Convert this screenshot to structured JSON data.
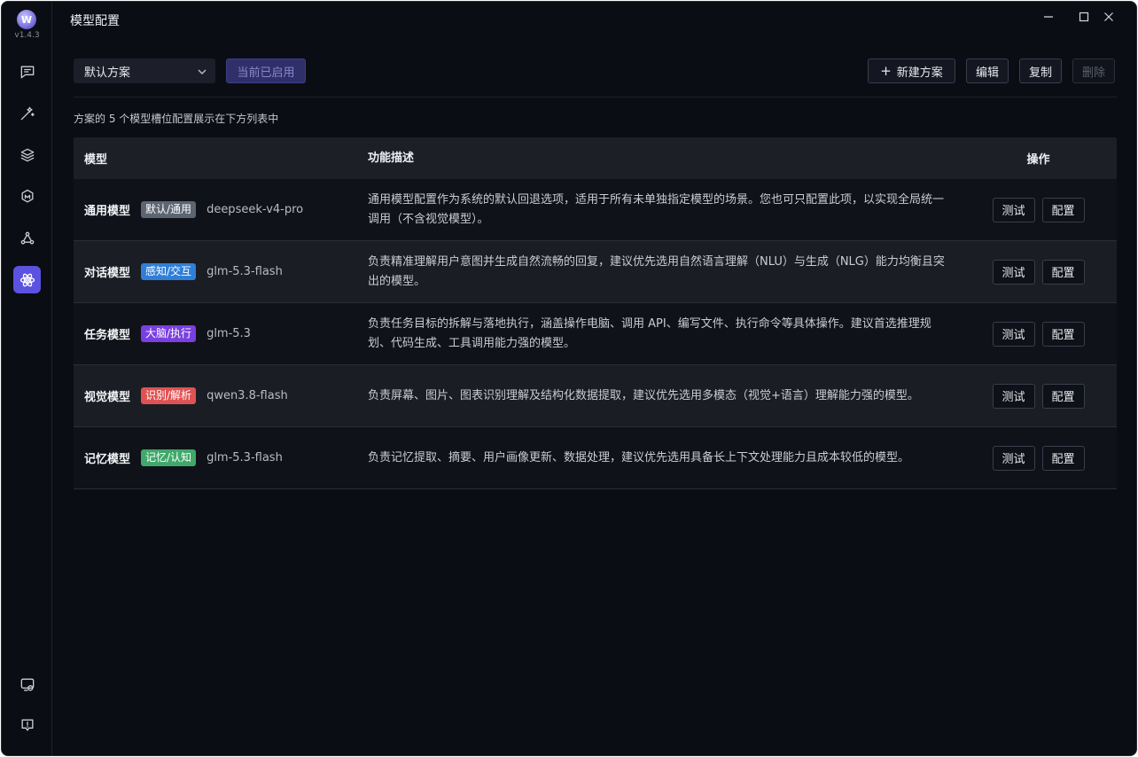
{
  "app": {
    "version": "v1.4.3",
    "logo_letter": "W"
  },
  "window": {
    "title": "模型配置"
  },
  "sidebar": {
    "nav": [
      {
        "icon": "chat-settings-icon"
      },
      {
        "icon": "magic-wand-icon"
      },
      {
        "icon": "layers-icon"
      },
      {
        "icon": "model-badge-icon"
      },
      {
        "icon": "network-icon"
      },
      {
        "icon": "atom-icon",
        "active": true
      }
    ],
    "bottom": [
      {
        "icon": "settings-screen-icon"
      },
      {
        "icon": "info-icon"
      }
    ]
  },
  "toolbar": {
    "scheme_value": "默认方案",
    "current_enabled_label": "当前已启用",
    "new_scheme_label": "新建方案",
    "edit_label": "编辑",
    "copy_label": "复制",
    "delete_label": "删除"
  },
  "summary": "方案的 5 个模型槽位配置展示在下方列表中",
  "table": {
    "headers": {
      "model": "模型",
      "desc": "功能描述",
      "ops": "操作"
    },
    "test_label": "测试",
    "config_label": "配置",
    "rows": [
      {
        "name": "通用模型",
        "tag": "默认/通用",
        "tag_color": "#5d6472",
        "model": "deepseek-v4-pro",
        "desc": "通用模型配置作为系统的默认回退选项，适用于所有未单独指定模型的场景。您也可只配置此项，以实现全局统一调用（不含视觉模型）。"
      },
      {
        "name": "对话模型",
        "tag": "感知/交互",
        "tag_color": "#2f7fd8",
        "model": "glm-5.3-flash",
        "desc": "负责精准理解用户意图并生成自然流畅的回复，建议优先选用自然语言理解（NLU）与生成（NLG）能力均衡且突出的模型。"
      },
      {
        "name": "任务模型",
        "tag": "大脑/执行",
        "tag_color": "#7a3fe0",
        "model": "glm-5.3",
        "desc": "负责任务目标的拆解与落地执行，涵盖操作电脑、调用 API、编写文件、执行命令等具体操作。建议首选推理规划、代码生成、工具调用能力强的模型。"
      },
      {
        "name": "视觉模型",
        "tag": "识别/解析",
        "tag_color": "#e05252",
        "model": "qwen3.8-flash",
        "desc": "负责屏幕、图片、图表识别理解及结构化数据提取，建议优先选用多模态（视觉+语言）理解能力强的模型。"
      },
      {
        "name": "记忆模型",
        "tag": "记忆/认知",
        "tag_color": "#3fa86a",
        "model": "glm-5.3-flash",
        "desc": "负责记忆提取、摘要、用户画像更新、数据处理，建议优先选用具备长上下文处理能力且成本较低的模型。"
      }
    ]
  }
}
